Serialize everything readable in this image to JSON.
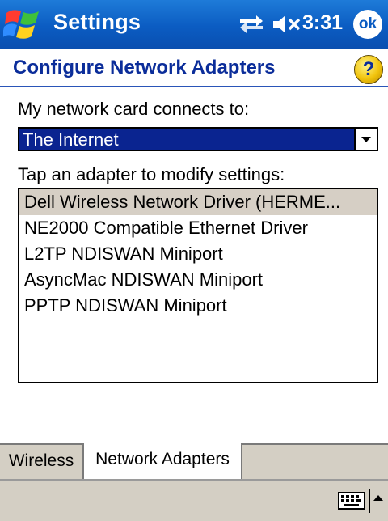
{
  "titlebar": {
    "app_title": "Settings",
    "clock": "3:31",
    "ok_label": "ok",
    "icons": [
      "windows-start-icon",
      "connectivity-icon",
      "volume-muted-icon"
    ]
  },
  "header": {
    "title": "Configure Network Adapters",
    "help_label": "?"
  },
  "form": {
    "connects_label": "My network card connects to:",
    "network_select": {
      "value": "The Internet"
    },
    "adapters_label": "Tap an adapter to modify settings:",
    "adapters": [
      {
        "label": "Dell Wireless Network Driver (HERME...",
        "selected": true
      },
      {
        "label": "NE2000 Compatible Ethernet Driver",
        "selected": false
      },
      {
        "label": "L2TP NDISWAN Miniport",
        "selected": false
      },
      {
        "label": "AsyncMac NDISWAN Miniport",
        "selected": false
      },
      {
        "label": "PPTP NDISWAN Miniport",
        "selected": false
      }
    ]
  },
  "tabs": [
    {
      "label": "Wireless",
      "active": false
    },
    {
      "label": "Network Adapters",
      "active": true
    }
  ],
  "bottombar": {
    "icons": [
      "keyboard-icon",
      "sip-arrow-up-icon"
    ]
  },
  "colors": {
    "titlebar": "#0b5cc2",
    "header_text": "#0b2d9a",
    "select_bg": "#0a2490",
    "selected_row": "#d6cfc5",
    "chrome": "#d4cfc4"
  }
}
